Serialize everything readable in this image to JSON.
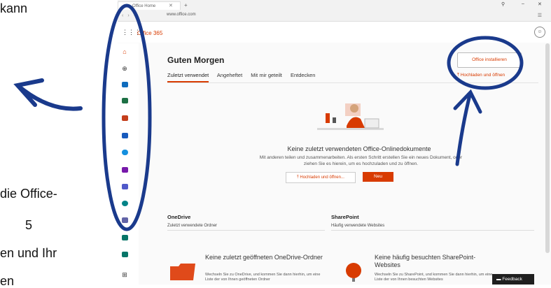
{
  "document": {
    "line1": "kann",
    "line2": "die Office-",
    "line3": "5",
    "line4": "en und Ihr",
    "line5": "en"
  },
  "browser": {
    "tab_title": "Office Home",
    "url": "www.office.com",
    "window_controls": [
      "🔍",
      "–",
      "✕"
    ]
  },
  "office": {
    "app_name": "Office 365",
    "greeting": "Guten Morgen",
    "tabs": [
      "Zuletzt verwendet",
      "Angeheftet",
      "Mit mir geteilt",
      "Entdecken"
    ],
    "install_button": "Office installieren",
    "upload_link": "Hochladen und öffnen",
    "empty_title": "Keine zuletzt verwendeten Office-Onlinedokumente",
    "empty_desc": "Mit anderen teilen und zusammenarbeiten. Als ersten Schritt erstellen Sie ein neues Dokument, oder ziehen Sie es hierein, um es hochzuladen und zu öffnen.",
    "upload_btn": "Hochladen und öffnen...",
    "new_btn": "Neu",
    "onedrive": {
      "title": "OneDrive",
      "subtitle": "Zuletzt verwendete Ordner",
      "empty_title": "Keine zuletzt geöffneten OneDrive-Ordner",
      "empty_desc": "Wechseln Sie zu OneDrive, und kommen Sie dann hierhin, um eine Liste der von Ihnen geöffneten Ordner"
    },
    "sharepoint": {
      "title": "SharePoint",
      "subtitle": "Häufig verwendete Websites",
      "empty_title": "Keine häufig besuchten SharePoint-Websites",
      "empty_desc": "Wechseln Sie zu SharePoint, und kommen Sie dann hierhin, um eine Liste der von Ihnen besuchten Websites"
    },
    "feedback": "Feedback"
  },
  "colors": {
    "accent": "#d83b01",
    "annotation": "#1a3a8c"
  }
}
